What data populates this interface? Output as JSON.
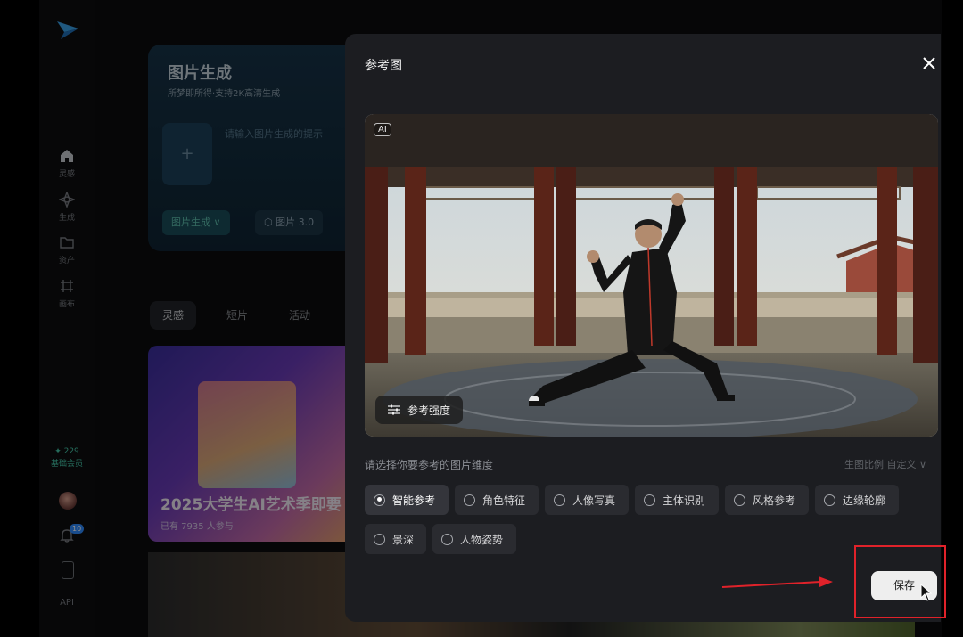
{
  "sidebar": {
    "items": [
      {
        "label": "灵感",
        "icon": "home-icon"
      },
      {
        "label": "生成",
        "icon": "sparkle-icon"
      },
      {
        "label": "资产",
        "icon": "folder-icon"
      },
      {
        "label": "画布",
        "icon": "canvas-icon"
      }
    ],
    "credits": "✦ 229",
    "membership": "基础会员",
    "notification_count": "10",
    "api_label": "API"
  },
  "background": {
    "card_title": "图片生成",
    "card_subtitle": "所梦即所得·支持2K高清生成",
    "prompt_placeholder": "请输入图片生成的提示",
    "upload_plus": "+",
    "mode_chip": "图片生成",
    "model_chip": "图片 3.0",
    "tabs": [
      "灵感",
      "短片",
      "活动"
    ],
    "banner_title": "2025大学生AI艺术季即要",
    "banner_sub": "已有 7935 人参与"
  },
  "modal": {
    "title": "参考图",
    "ai_tag": "AI",
    "strength_button": "参考强度",
    "dimension_prompt": "请选择你要参考的图片维度",
    "ratio_label": "生图比例 自定义 ∨",
    "options": [
      {
        "label": "智能参考",
        "selected": true
      },
      {
        "label": "角色特征",
        "selected": false
      },
      {
        "label": "人像写真",
        "selected": false
      },
      {
        "label": "主体识别",
        "selected": false
      },
      {
        "label": "风格参考",
        "selected": false
      },
      {
        "label": "边缘轮廓",
        "selected": false
      },
      {
        "label": "景深",
        "selected": false
      },
      {
        "label": "人物姿势",
        "selected": false
      }
    ],
    "save_button": "保存"
  },
  "colors": {
    "accent_teal": "#46c7a9",
    "annotation_red": "#e0222a",
    "modal_bg": "#1c1d21"
  }
}
